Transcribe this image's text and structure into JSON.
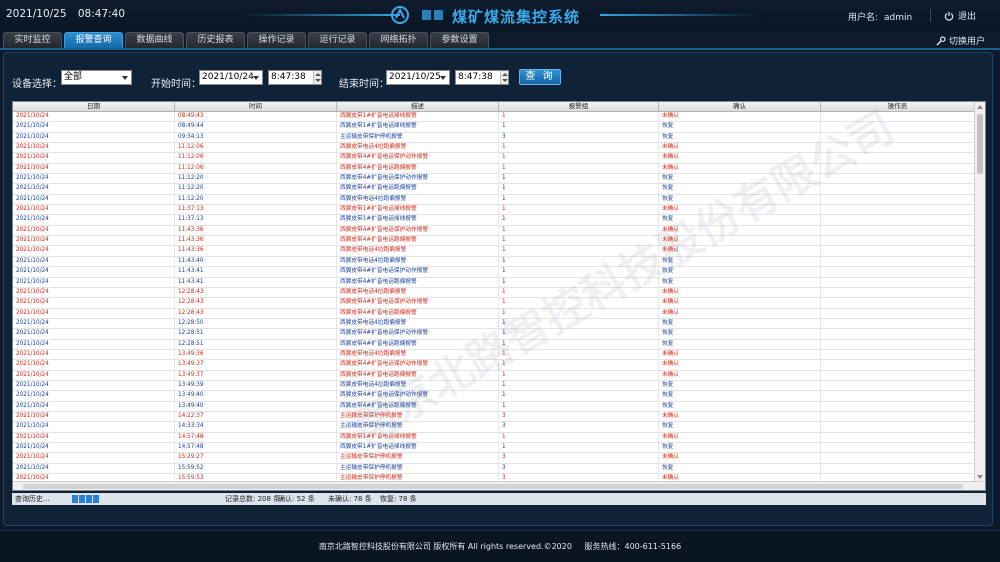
{
  "header": {
    "date": "2021/10/25",
    "time": "08:47:40",
    "title": "煤矿煤流集控系统",
    "user_label": "用户名:",
    "username": "admin",
    "logout_label": "退出"
  },
  "tabs": [
    {
      "label": "实时监控",
      "active": false
    },
    {
      "label": "报警查询",
      "active": true
    },
    {
      "label": "数据曲线",
      "active": false
    },
    {
      "label": "历史报表",
      "active": false
    },
    {
      "label": "操作记录",
      "active": false
    },
    {
      "label": "运行记录",
      "active": false
    },
    {
      "label": "网络拓扑",
      "active": false
    },
    {
      "label": "参数设置",
      "active": false
    }
  ],
  "switch_user_label": "切换用户",
  "filters": {
    "device_label": "设备选择：",
    "device_value": "全部",
    "start_label": "开始时间：",
    "start_date": "2021/10/24",
    "start_time": "8:47:38",
    "end_label": "结束时间：",
    "end_date": "2021/10/25",
    "end_time": "8:47:38",
    "query_button": "查 询"
  },
  "table": {
    "columns": [
      "日期",
      "时间",
      "描述",
      "报警组",
      "确认",
      "操作员"
    ],
    "rows": [
      {
        "date": "2021/10/24",
        "time": "08:49:43",
        "desc": "西翼皮带1#扩音电话掉线报警",
        "group": "1",
        "confirm": "未确认",
        "status": "unack"
      },
      {
        "date": "2021/10/24",
        "time": "08:49:44",
        "desc": "西翼皮带1#扩音电话掉线报警",
        "group": "1",
        "confirm": "恢复",
        "status": "ack"
      },
      {
        "date": "2021/10/24",
        "time": "09:34:13",
        "desc": "主运输皮带保护停机报警",
        "group": "3",
        "confirm": "恢复",
        "status": "ack"
      },
      {
        "date": "2021/10/24",
        "time": "11:12:06",
        "desc": "西翼皮带电话4拉跑偏报警",
        "group": "1",
        "confirm": "未确认",
        "status": "unack"
      },
      {
        "date": "2021/10/24",
        "time": "11:12:06",
        "desc": "西翼皮带4#扩音电话保护动作报警",
        "group": "1",
        "confirm": "未确认",
        "status": "unack"
      },
      {
        "date": "2021/10/24",
        "time": "11:12:06",
        "desc": "西翼皮带4#扩音电话跑偏报警",
        "group": "1",
        "confirm": "未确认",
        "status": "unack"
      },
      {
        "date": "2021/10/24",
        "time": "11:12:20",
        "desc": "西翼皮带4#扩音电话保护动作报警",
        "group": "1",
        "confirm": "恢复",
        "status": "ack"
      },
      {
        "date": "2021/10/24",
        "time": "11:12:20",
        "desc": "西翼皮带4#扩音电话跑偏报警",
        "group": "1",
        "confirm": "恢复",
        "status": "ack"
      },
      {
        "date": "2021/10/24",
        "time": "11:12:20",
        "desc": "西翼皮带电话4拉跑偏报警",
        "group": "1",
        "confirm": "恢复",
        "status": "ack"
      },
      {
        "date": "2021/10/24",
        "time": "11:37:13",
        "desc": "西翼皮带1#扩音电话掉线报警",
        "group": "1",
        "confirm": "未确认",
        "status": "unack"
      },
      {
        "date": "2021/10/24",
        "time": "11:37:13",
        "desc": "西翼皮带1#扩音电话掉线报警",
        "group": "1",
        "confirm": "恢复",
        "status": "ack"
      },
      {
        "date": "2021/10/24",
        "time": "11:43:36",
        "desc": "西翼皮带4#扩音电话保护动作报警",
        "group": "1",
        "confirm": "未确认",
        "status": "unack"
      },
      {
        "date": "2021/10/24",
        "time": "11:43:36",
        "desc": "西翼皮带4#扩音电话跑偏报警",
        "group": "1",
        "confirm": "未确认",
        "status": "unack"
      },
      {
        "date": "2021/10/24",
        "time": "11:43:36",
        "desc": "西翼皮带电话4拉跑偏报警",
        "group": "1",
        "confirm": "未确认",
        "status": "unack"
      },
      {
        "date": "2021/10/24",
        "time": "11:43:40",
        "desc": "西翼皮带电话4拉跑偏报警",
        "group": "1",
        "confirm": "恢复",
        "status": "ack"
      },
      {
        "date": "2021/10/24",
        "time": "11:43:41",
        "desc": "西翼皮带4#扩音电话保护动作报警",
        "group": "1",
        "confirm": "恢复",
        "status": "ack"
      },
      {
        "date": "2021/10/24",
        "time": "11:43:41",
        "desc": "西翼皮带4#扩音电话跑偏报警",
        "group": "1",
        "confirm": "恢复",
        "status": "ack"
      },
      {
        "date": "2021/10/24",
        "time": "12:28:43",
        "desc": "西翼皮带电话4拉跑偏报警",
        "group": "1",
        "confirm": "未确认",
        "status": "unack"
      },
      {
        "date": "2021/10/24",
        "time": "12:28:43",
        "desc": "西翼皮带4#扩音电话保护动作报警",
        "group": "1",
        "confirm": "未确认",
        "status": "unack"
      },
      {
        "date": "2021/10/24",
        "time": "12:28:43",
        "desc": "西翼皮带4#扩音电话跑偏报警",
        "group": "1",
        "confirm": "未确认",
        "status": "unack"
      },
      {
        "date": "2021/10/24",
        "time": "12:28:50",
        "desc": "西翼皮带电话4拉跑偏报警",
        "group": "1",
        "confirm": "恢复",
        "status": "ack"
      },
      {
        "date": "2021/10/24",
        "time": "12:28:51",
        "desc": "西翼皮带4#扩音电话保护动作报警",
        "group": "1",
        "confirm": "恢复",
        "status": "ack"
      },
      {
        "date": "2021/10/24",
        "time": "12:28:51",
        "desc": "西翼皮带4#扩音电话跑偏报警",
        "group": "1",
        "confirm": "恢复",
        "status": "ack"
      },
      {
        "date": "2021/10/24",
        "time": "13:49:36",
        "desc": "西翼皮带电话4拉跑偏报警",
        "group": "1",
        "confirm": "未确认",
        "status": "unack"
      },
      {
        "date": "2021/10/24",
        "time": "13:49:37",
        "desc": "西翼皮带4#扩音电话保护动作报警",
        "group": "1",
        "confirm": "未确认",
        "status": "unack"
      },
      {
        "date": "2021/10/24",
        "time": "13:49:37",
        "desc": "西翼皮带4#扩音电话跑偏报警",
        "group": "1",
        "confirm": "未确认",
        "status": "unack"
      },
      {
        "date": "2021/10/24",
        "time": "13:49:39",
        "desc": "西翼皮带电话4拉跑偏报警",
        "group": "1",
        "confirm": "恢复",
        "status": "ack"
      },
      {
        "date": "2021/10/24",
        "time": "13:49:40",
        "desc": "西翼皮带4#扩音电话保护动作报警",
        "group": "1",
        "confirm": "恢复",
        "status": "ack"
      },
      {
        "date": "2021/10/24",
        "time": "13:49:40",
        "desc": "西翼皮带4#扩音电话跑偏报警",
        "group": "1",
        "confirm": "恢复",
        "status": "ack"
      },
      {
        "date": "2021/10/24",
        "time": "14:22:37",
        "desc": "主运输皮带保护停机报警",
        "group": "3",
        "confirm": "未确认",
        "status": "unack"
      },
      {
        "date": "2021/10/24",
        "time": "14:33:34",
        "desc": "主运输皮带保护停机报警",
        "group": "3",
        "confirm": "恢复",
        "status": "ack"
      },
      {
        "date": "2021/10/24",
        "time": "14:57:48",
        "desc": "西翼皮带1#扩音电话掉线报警",
        "group": "1",
        "confirm": "未确认",
        "status": "unack"
      },
      {
        "date": "2021/10/24",
        "time": "14:57:48",
        "desc": "西翼皮带1#扩音电话掉线报警",
        "group": "1",
        "confirm": "恢复",
        "status": "ack"
      },
      {
        "date": "2021/10/24",
        "time": "15:29:27",
        "desc": "主运输皮带保护停机报警",
        "group": "3",
        "confirm": "未确认",
        "status": "unack"
      },
      {
        "date": "2021/10/24",
        "time": "15:59:52",
        "desc": "主运输皮带保护停机报警",
        "group": "3",
        "confirm": "恢复",
        "status": "ack"
      },
      {
        "date": "2021/10/24",
        "time": "15:59:53",
        "desc": "主运输皮带保护停机报警",
        "group": "3",
        "confirm": "未确认",
        "status": "unack"
      }
    ]
  },
  "statusbar": {
    "query_label": "查询历史...",
    "total": "记录总数: 208 条",
    "confirmed": "确认: 52 条",
    "unconfirmed": "未确认: 78 条",
    "recovered": "恢复: 78 条"
  },
  "watermark": "南京北路智控科技股份有限公司",
  "footer": {
    "copyright": "南京北路智控科技股份有限公司 版权所有 All rights reserved.©2020",
    "hotline": "服务热线：400-611-5166"
  },
  "colors": {
    "unack_text": "#d12a1c",
    "ack_text": "#1a3f9e",
    "accent": "#2f93d8",
    "title": "#37a9e8"
  }
}
